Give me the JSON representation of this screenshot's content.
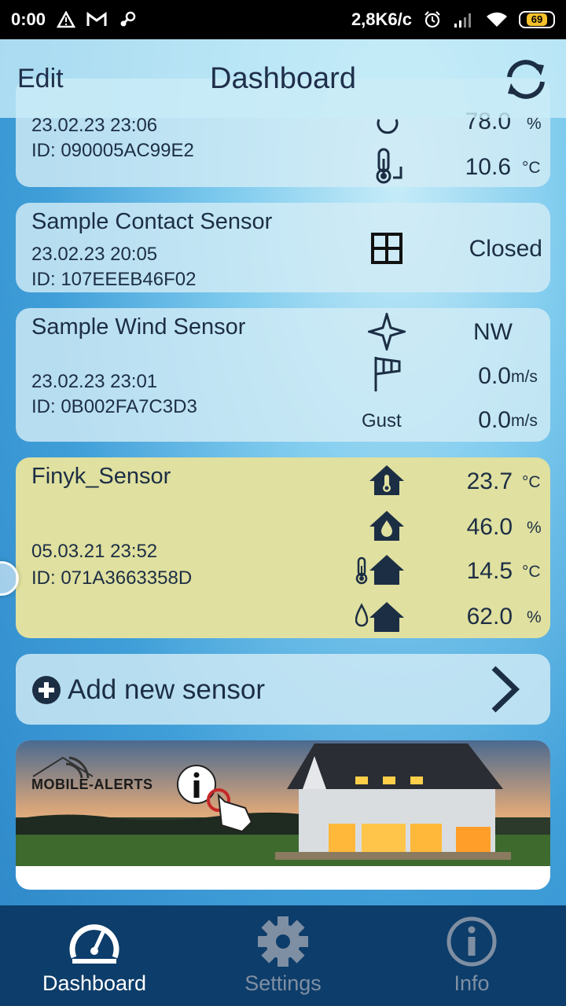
{
  "status_bar": {
    "time": "0:00",
    "speed": "2,8K6/c",
    "battery": "69"
  },
  "header": {
    "edit_label": "Edit",
    "title": "Dashboard"
  },
  "sensors": [
    {
      "date": "23.02.23  23:06",
      "id": "ID: 090005AC99E2",
      "humidity": "78.0",
      "humidity_unit": "%",
      "temperature": "10.6",
      "temperature_unit": "°C"
    },
    {
      "name": "Sample Contact Sensor",
      "date": "23.02.23  20:05",
      "id": "ID: 107EEEB46F02",
      "state": "Closed"
    },
    {
      "name": "Sample Wind Sensor",
      "date": "23.02.23  23:01",
      "id": "ID: 0B002FA7C3D3",
      "direction": "NW",
      "speed": "0.0",
      "speed_unit": "m/s",
      "gust_label": "Gust",
      "gust": "0.0",
      "gust_unit": "m/s"
    },
    {
      "name": "Finyk_Sensor",
      "date": "05.03.21  23:52",
      "id": "ID: 071A3663358D",
      "in_temp": "23.7",
      "in_temp_unit": "°C",
      "in_hum": "46.0",
      "in_hum_unit": "%",
      "out_temp": "14.5",
      "out_temp_unit": "°C",
      "out_hum": "62.0",
      "out_hum_unit": "%"
    }
  ],
  "add_sensor": {
    "label": "Add new sensor"
  },
  "banner": {
    "logo_text": "MOBILE-ALERTS"
  },
  "tabs": [
    {
      "label": "Dashboard",
      "color": "#ffffff"
    },
    {
      "label": "Settings",
      "color": "#7f8fa3"
    },
    {
      "label": "Info",
      "color": "#7f8fa3"
    }
  ]
}
